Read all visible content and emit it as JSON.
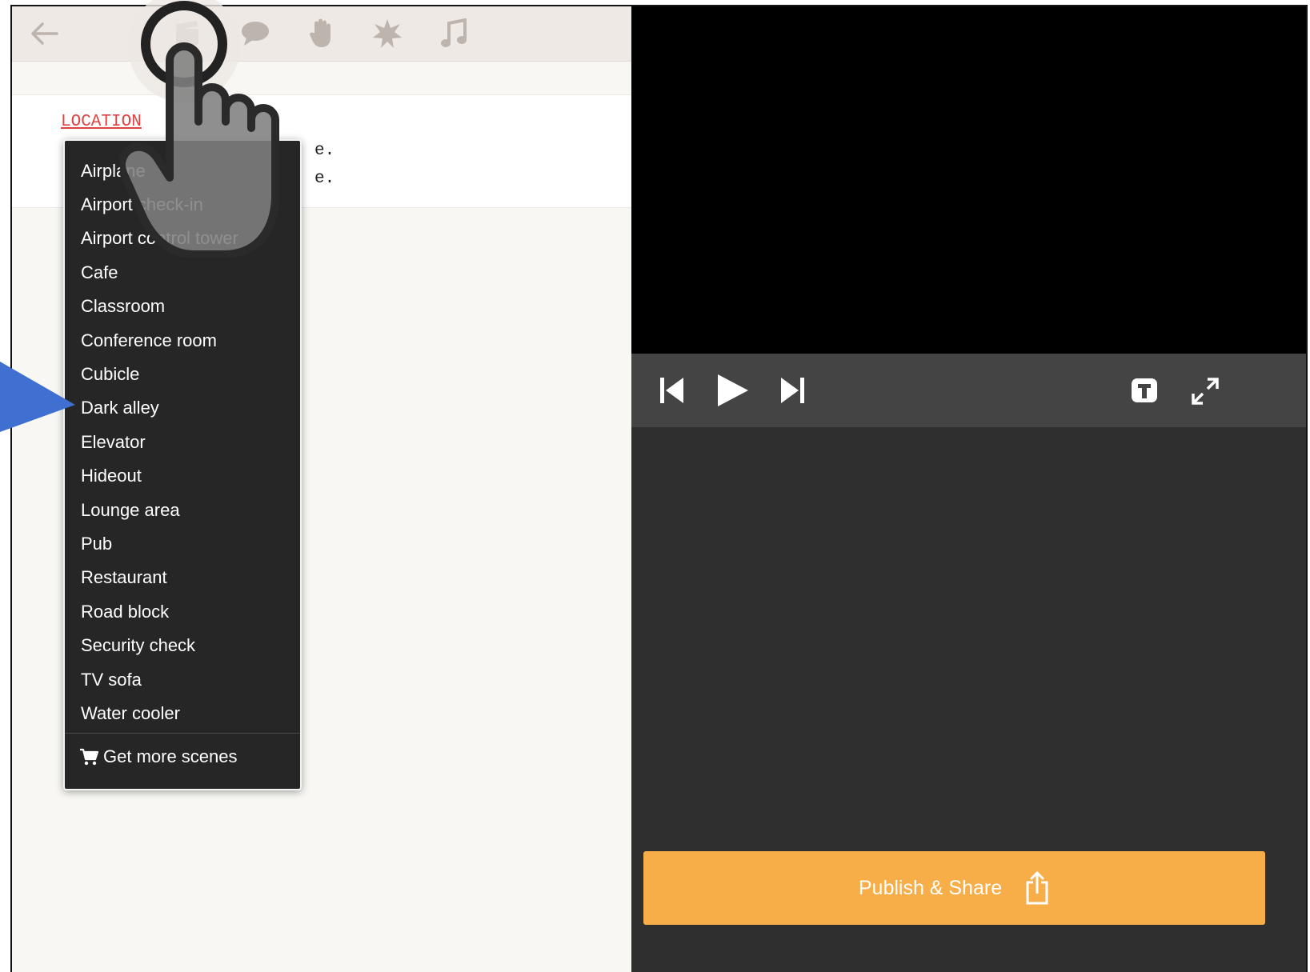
{
  "toolbar": {
    "icons": [
      "back-arrow-icon",
      "clapperboard-icon",
      "speech-bubble-icon",
      "hand-icon",
      "burst-icon",
      "music-note-icon"
    ]
  },
  "script": {
    "location_label": "LOCATION",
    "line1_visible": "e.",
    "line2_visible": "e."
  },
  "scene_menu": {
    "items": [
      "Airplane",
      "Airport check-in",
      "Airport control tower",
      "Cafe",
      "Classroom",
      "Conference room",
      "Cubicle",
      "Dark alley",
      "Elevator",
      "Hideout",
      "Lounge area",
      "Pub",
      "Restaurant",
      "Road block",
      "Security check",
      "TV sofa",
      "Water cooler"
    ],
    "get_more_label": "Get more scenes",
    "get_more_icon": "cart-icon"
  },
  "player": {
    "controls": [
      "skip-back-icon",
      "play-icon",
      "skip-forward-icon",
      "text-toggle-icon",
      "fullscreen-icon"
    ]
  },
  "publish": {
    "label": "Publish & Share",
    "icon": "share-icon"
  },
  "colors": {
    "accent": "#f7ae48",
    "menu_bg": "#262626",
    "location_red": "#e04242",
    "overlay_arrow": "#3f6fd0"
  }
}
